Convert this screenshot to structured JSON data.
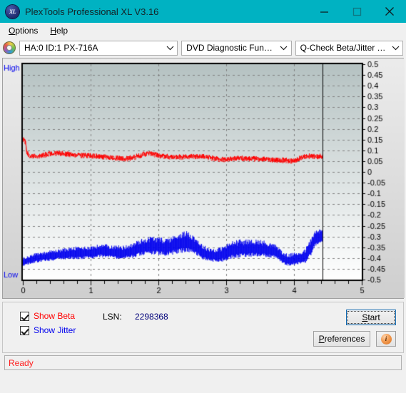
{
  "window": {
    "title": "PlexTools Professional XL V3.16",
    "app_icon": "xl-logo-icon",
    "minimize_label": "minimize-icon",
    "maximize_label": "maximize-icon",
    "close_label": "close-icon",
    "titlebar_color": "#00b2c2"
  },
  "menubar": {
    "items": [
      {
        "label": "Options",
        "accel": "O"
      },
      {
        "label": "Help",
        "accel": "H"
      }
    ]
  },
  "toolbar": {
    "disc_icon": "optical-disc-icon",
    "drive_select": {
      "value": "HA:0 ID:1  PX-716A",
      "options": [
        "HA:0 ID:1  PX-716A"
      ]
    },
    "function_select": {
      "value": "DVD Diagnostic Functions",
      "options": [
        "DVD Diagnostic Functions"
      ]
    },
    "test_select": {
      "value": "Q-Check Beta/Jitter Test",
      "options": [
        "Q-Check Beta/Jitter Test"
      ]
    }
  },
  "controls": {
    "show_beta_label": "Show Beta",
    "show_beta_checked": true,
    "show_beta_color": "#ff0000",
    "show_jitter_label": "Show Jitter",
    "show_jitter_checked": true,
    "show_jitter_color": "#0000ee",
    "lsn_label": "LSN:",
    "lsn_value": "2298368",
    "start_label": "Start",
    "preferences_label": "Preferences",
    "info_label": "i"
  },
  "statusbar": {
    "text": "Ready"
  },
  "chart_data": {
    "type": "line",
    "title": "",
    "xlabel": "",
    "ylabel": "",
    "axis_left_top_label": "High",
    "axis_left_bottom_label": "Low",
    "axis_label_color": "#0000ee",
    "xlim": [
      0,
      5
    ],
    "ylim": [
      -0.5,
      0.5
    ],
    "x_ticks": [
      0,
      1,
      2,
      3,
      4,
      5
    ],
    "x_tick_labels": [
      "0",
      "1",
      "2",
      "3",
      "4",
      "5"
    ],
    "x_minor_ticks_per_major": 5,
    "y_ticks": [
      0.5,
      0.45,
      0.4,
      0.35,
      0.3,
      0.25,
      0.2,
      0.15,
      0.1,
      0.05,
      0,
      -0.05,
      -0.1,
      -0.15,
      -0.2,
      -0.25,
      -0.3,
      -0.35,
      -0.4,
      -0.45,
      -0.5
    ],
    "y_tick_labels": [
      "0.5",
      "0.45",
      "0.4",
      "0.35",
      "0.3",
      "0.25",
      "0.2",
      "0.15",
      "0.1",
      "0.05",
      "0",
      "-0.05",
      "-0.1",
      "-0.15",
      "-0.2",
      "-0.25",
      "-0.3",
      "-0.35",
      "-0.4",
      "-0.45",
      "-0.5"
    ],
    "grid": true,
    "grid_style": "dashed",
    "grid_color": "#808080",
    "vertical_grid_at": [
      1,
      2,
      3,
      4
    ],
    "plot_bg_gradient": [
      "#b5c2c2",
      "#ffffff"
    ],
    "data_end_marker_x": 4.42,
    "series": [
      {
        "name": "Beta",
        "color": "#ff0000",
        "type": "noisy-line",
        "noise_amplitude": 0.012,
        "x": [
          0.0,
          0.02,
          0.04,
          0.06,
          0.1,
          0.16,
          0.24,
          0.34,
          0.45,
          0.58,
          0.72,
          0.85,
          0.98,
          1.12,
          1.26,
          1.4,
          1.52,
          1.62,
          1.7,
          1.78,
          1.86,
          1.94,
          2.02,
          2.12,
          2.24,
          2.38,
          2.52,
          2.62,
          2.7,
          2.8,
          2.92,
          3.04,
          3.16,
          3.28,
          3.4,
          3.52,
          3.64,
          3.76,
          3.86,
          3.96,
          4.04,
          4.12,
          4.2,
          4.3,
          4.42
        ],
        "y": [
          0.15,
          0.148,
          0.14,
          0.09,
          0.072,
          0.072,
          0.075,
          0.082,
          0.086,
          0.086,
          0.082,
          0.078,
          0.076,
          0.072,
          0.068,
          0.064,
          0.062,
          0.066,
          0.074,
          0.082,
          0.086,
          0.082,
          0.076,
          0.072,
          0.07,
          0.07,
          0.072,
          0.074,
          0.072,
          0.064,
          0.058,
          0.06,
          0.064,
          0.064,
          0.062,
          0.06,
          0.058,
          0.056,
          0.054,
          0.052,
          0.056,
          0.07,
          0.074,
          0.072,
          0.072
        ]
      },
      {
        "name": "Jitter",
        "color": "#0000ee",
        "type": "noisy-band",
        "x": [
          0.0,
          0.08,
          0.18,
          0.3,
          0.42,
          0.55,
          0.68,
          0.8,
          0.92,
          1.02,
          1.12,
          1.24,
          1.36,
          1.48,
          1.6,
          1.7,
          1.8,
          1.9,
          2.0,
          2.1,
          2.2,
          2.3,
          2.4,
          2.5,
          2.58,
          2.66,
          2.76,
          2.86,
          2.96,
          3.08,
          3.2,
          3.32,
          3.44,
          3.56,
          3.66,
          3.76,
          3.84,
          3.92,
          4.0,
          4.08,
          4.16,
          4.24,
          4.3,
          4.36,
          4.42
        ],
        "y_center": [
          -0.42,
          -0.412,
          -0.402,
          -0.396,
          -0.392,
          -0.386,
          -0.382,
          -0.38,
          -0.378,
          -0.376,
          -0.37,
          -0.372,
          -0.376,
          -0.378,
          -0.372,
          -0.36,
          -0.352,
          -0.346,
          -0.35,
          -0.354,
          -0.348,
          -0.336,
          -0.33,
          -0.338,
          -0.356,
          -0.378,
          -0.388,
          -0.392,
          -0.384,
          -0.368,
          -0.362,
          -0.36,
          -0.358,
          -0.362,
          -0.368,
          -0.378,
          -0.404,
          -0.412,
          -0.408,
          -0.404,
          -0.398,
          -0.36,
          -0.318,
          -0.306,
          -0.3
        ],
        "band_halfwidth": [
          0.018,
          0.018,
          0.02,
          0.02,
          0.022,
          0.022,
          0.024,
          0.026,
          0.026,
          0.026,
          0.026,
          0.028,
          0.028,
          0.028,
          0.03,
          0.034,
          0.036,
          0.038,
          0.036,
          0.036,
          0.038,
          0.042,
          0.044,
          0.04,
          0.034,
          0.03,
          0.028,
          0.028,
          0.032,
          0.036,
          0.038,
          0.036,
          0.036,
          0.034,
          0.03,
          0.028,
          0.024,
          0.024,
          0.026,
          0.028,
          0.03,
          0.036,
          0.034,
          0.03,
          0.028
        ]
      }
    ]
  }
}
